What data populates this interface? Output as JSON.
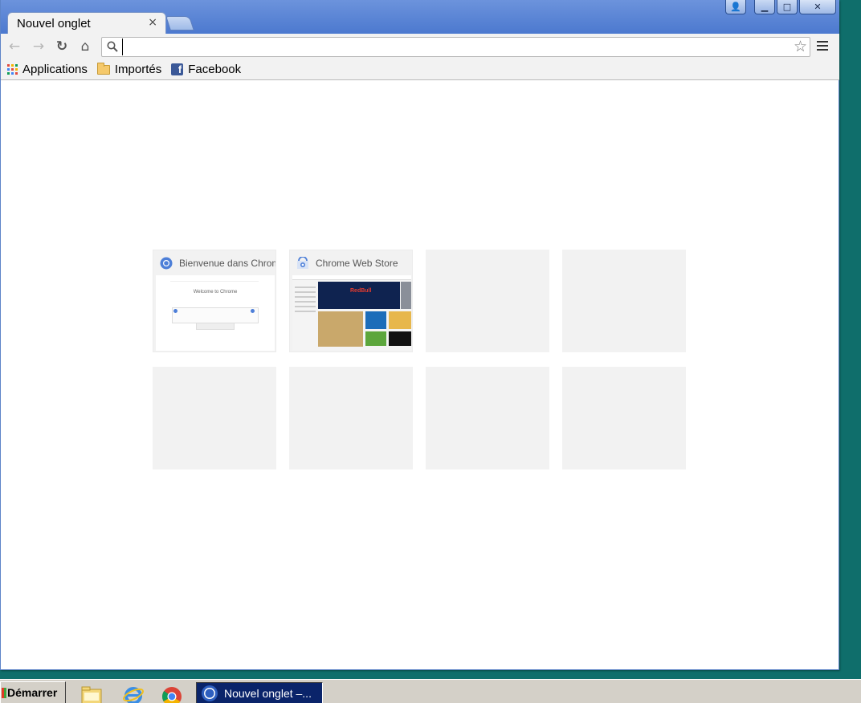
{
  "tab": {
    "title": "Nouvel onglet",
    "close_glyph": "×"
  },
  "window_controls": {
    "user_glyph": "👤",
    "minimize_glyph": "▁",
    "maximize_glyph": "□",
    "close_glyph": "✕"
  },
  "toolbar": {
    "back_glyph": "←",
    "forward_glyph": "→",
    "reload_glyph": "↻",
    "home_glyph": "⌂",
    "omnibox_value": "",
    "star_glyph": "☆"
  },
  "bookmarks": [
    {
      "label": "Applications",
      "icon": "apps-grid-icon"
    },
    {
      "label": "Importés",
      "icon": "folder-icon"
    },
    {
      "label": "Facebook",
      "icon": "facebook-icon",
      "icon_glyph": "f"
    }
  ],
  "tiles": [
    {
      "title": "Bienvenue dans Chrome",
      "thumbnail": "Welcome to Chrome",
      "filled": true
    },
    {
      "title": "Chrome Web Store",
      "thumbnail": "Chrome Web Store",
      "filled": true
    },
    {
      "title": "",
      "filled": false
    },
    {
      "title": "",
      "filled": false
    },
    {
      "title": "",
      "filled": false
    },
    {
      "title": "",
      "filled": false
    },
    {
      "title": "",
      "filled": false
    },
    {
      "title": "",
      "filled": false
    }
  ],
  "thumb_welcome": {
    "heading": "Welcome to Chrome"
  },
  "thumb_store": {
    "banner": "RedBull"
  },
  "taskbar": {
    "start_label": "Démarrer",
    "quick_launch": [
      "folder-icon",
      "internet-explorer-icon",
      "chrome-icon"
    ],
    "active_task": "Nouvel onglet –..."
  },
  "colors": {
    "desktop": "#0f6e6b",
    "titlebar": "#4c79cf",
    "tab": "#f2f2f2",
    "tile": "#f2f2f2",
    "task_active": "#0a246a"
  }
}
